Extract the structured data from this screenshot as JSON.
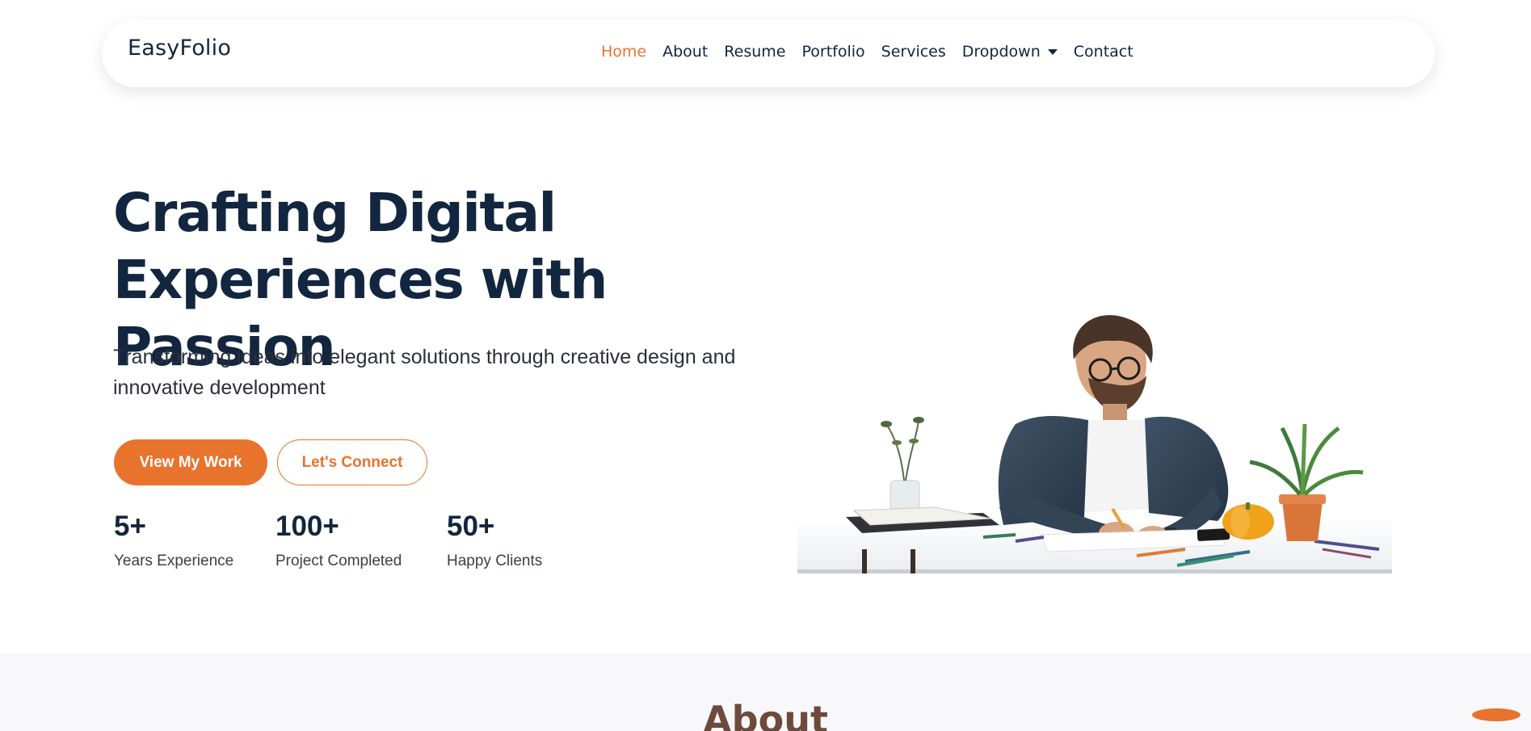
{
  "brand": {
    "name": "EasyFolio"
  },
  "nav": {
    "items": [
      {
        "label": "Home",
        "active": true
      },
      {
        "label": "About"
      },
      {
        "label": "Resume"
      },
      {
        "label": "Portfolio"
      },
      {
        "label": "Services"
      },
      {
        "label": "Dropdown",
        "has_caret": true
      },
      {
        "label": "Contact"
      }
    ]
  },
  "hero": {
    "title_line1": "Crafting Digital",
    "title_line2": "Experiences with Passion",
    "subtitle_line1": "Transforming ideas into elegant solutions through creative design and",
    "subtitle_line2": "innovative development",
    "primary_button": "View My Work",
    "secondary_button": "Let's Connect",
    "stats": [
      {
        "value": "5+",
        "label": "Years Experience"
      },
      {
        "value": "100+",
        "label": "Project Completed"
      },
      {
        "value": "50+",
        "label": "Happy Clients"
      }
    ],
    "image_icon": "designer-at-desk-illustration"
  },
  "about": {
    "title": "About"
  },
  "scroll_top": {
    "icon": "scroll-top-icon"
  },
  "colors": {
    "accent": "#e8732d",
    "heading": "#12263f",
    "about_title": "#6e4a3c",
    "section_bg": "#f8f8fa"
  }
}
